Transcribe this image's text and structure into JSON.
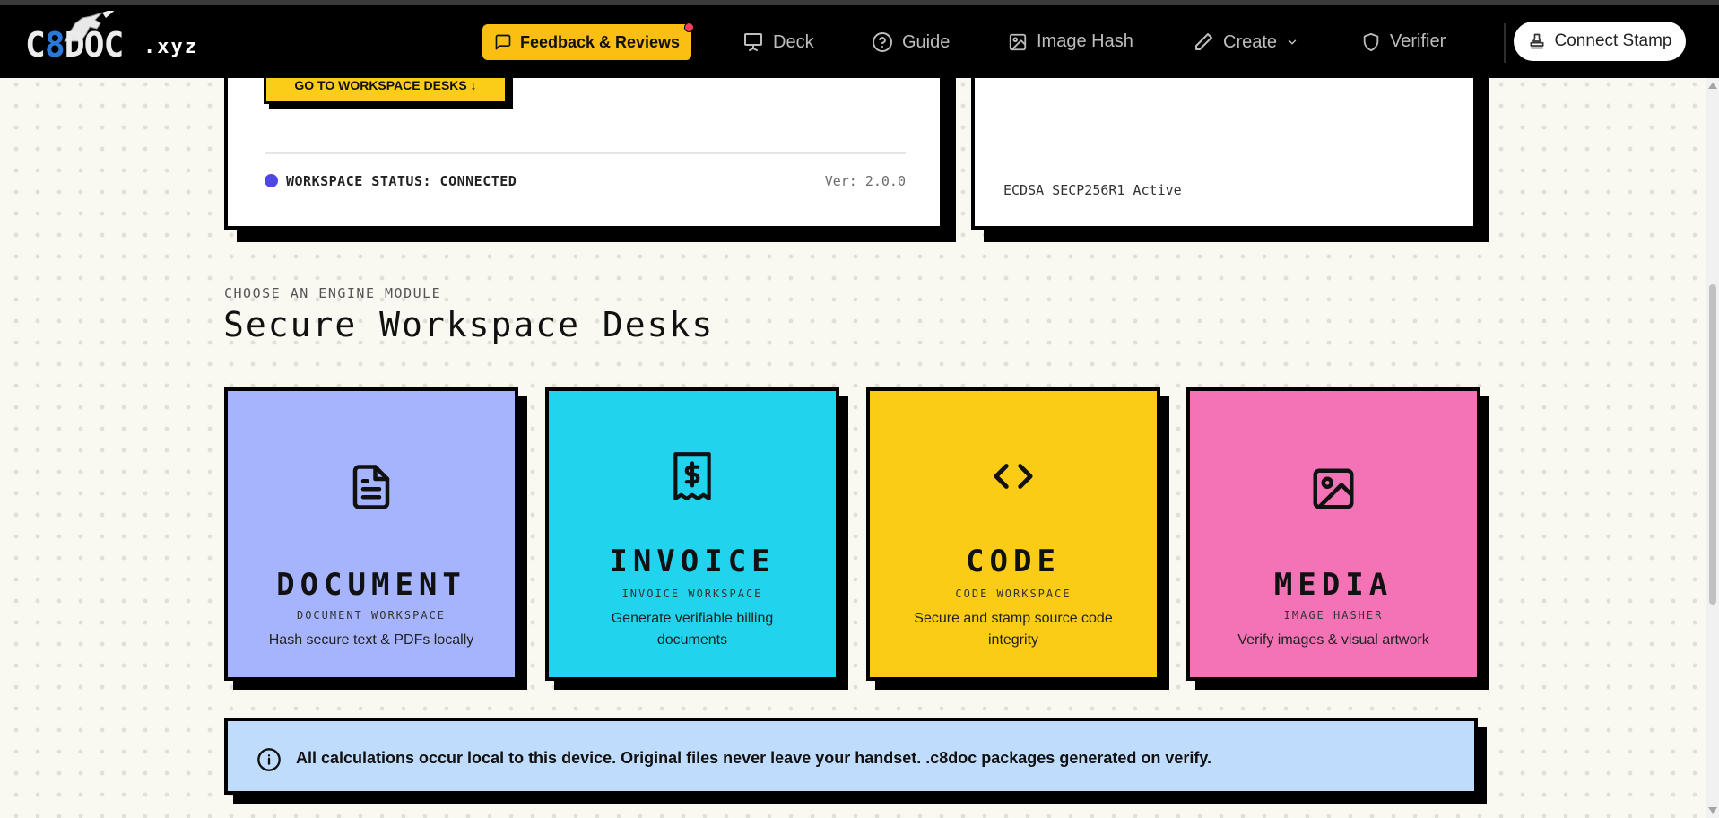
{
  "nav": {
    "logo_text": "C8DOC",
    "domain": ".xyz",
    "feedback_label": "Feedback & Reviews",
    "links": [
      "Deck",
      "Guide",
      "Image Hash",
      "Create",
      "Verifier"
    ],
    "connect_label": "Connect Stamp"
  },
  "workspace_panel": {
    "goto_label": "GO TO WORKSPACE DESKS ↓",
    "status": "WORKSPACE STATUS: CONNECTED",
    "version": "Ver: 2.0.0"
  },
  "crypto_panel": {
    "algorithm": "ECDSA SECP256R1 Active"
  },
  "section": {
    "eyebrow": "CHOOSE AN ENGINE MODULE",
    "title": "Secure Workspace Desks"
  },
  "desks": [
    {
      "name": "DOCUMENT",
      "sub": "DOCUMENT WORKSPACE",
      "desc": "Hash secure text & PDFs locally",
      "color": "#a5b4fc",
      "icon": "file-text-icon"
    },
    {
      "name": "INVOICE",
      "sub": "INVOICE WORKSPACE",
      "desc": "Generate verifiable billing documents",
      "color": "#22d3ee",
      "icon": "receipt-icon"
    },
    {
      "name": "CODE",
      "sub": "CODE WORKSPACE",
      "desc": "Secure and stamp source code integrity",
      "color": "#facc15",
      "icon": "code-icon"
    },
    {
      "name": "MEDIA",
      "sub": "IMAGE HASHER",
      "desc": "Verify images & visual artwork",
      "color": "#f472b6",
      "icon": "image-icon"
    }
  ],
  "info": {
    "text": "All calculations occur local to this device. Original files never leave your handset. .c8doc packages generated on verify."
  }
}
